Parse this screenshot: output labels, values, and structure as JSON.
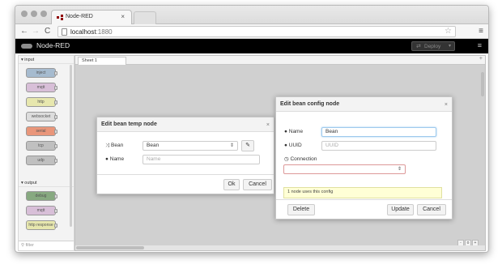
{
  "browser": {
    "tab_title": "Node-RED",
    "tab_close": "×",
    "url_host": "localhost",
    "url_port": ":1880",
    "icons": [
      "back-arrow-icon",
      "forward-arrow-icon",
      "reload-icon",
      "star-icon",
      "menu-icon"
    ]
  },
  "header": {
    "app_title": "Node-RED",
    "deploy_label": "Deploy",
    "menu_icon": "≡"
  },
  "palette": {
    "input_header": "▾ input",
    "output_header": "▾ output",
    "input_nodes": [
      {
        "label": "inject",
        "color": "#a6bbcf"
      },
      {
        "label": "mqtt",
        "color": "#d8bfd8"
      },
      {
        "label": "http",
        "color": "#e7e7ae"
      },
      {
        "label": "websocket",
        "color": "#dddddd"
      },
      {
        "label": "serial",
        "color": "#e9967a"
      },
      {
        "label": "tcp",
        "color": "#c0c0c0"
      },
      {
        "label": "udp",
        "color": "#c0c0c0"
      }
    ],
    "output_nodes": [
      {
        "label": "debug",
        "color": "#87a980"
      },
      {
        "label": "mqtt",
        "color": "#d8bfd8"
      },
      {
        "label": "http response",
        "color": "#e7e7ae"
      }
    ],
    "filter_placeholder": "filter"
  },
  "workspace": {
    "tab_label": "Sheet 1",
    "add_tab": "+",
    "zoom_controls": [
      "-",
      "o",
      "+"
    ]
  },
  "bean_temp_dialog": {
    "title": "Edit bean temp node",
    "close": "×",
    "bean_label": "Bean",
    "bean_value": "Bean",
    "name_label": "Name",
    "name_placeholder": "Name",
    "ok_label": "Ok",
    "cancel_label": "Cancel"
  },
  "bean_config_dialog": {
    "title": "Edit bean config node",
    "close": "×",
    "name_label": "Name",
    "name_value": "Bean",
    "uuid_label": "UUID",
    "uuid_placeholder": "UUID",
    "connection_label": "Connection",
    "connection_value": "",
    "usage_note": "1 node uses this config",
    "delete_label": "Delete",
    "update_label": "Update",
    "cancel_label": "Cancel"
  }
}
